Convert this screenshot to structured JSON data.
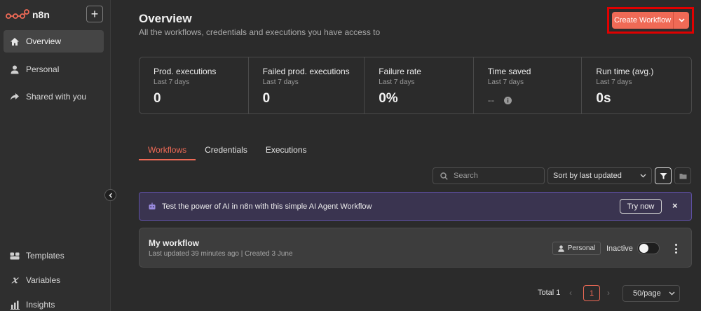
{
  "brand": {
    "name": "n8n",
    "accent": "#ef6a56"
  },
  "sidebar": {
    "new_label": "+",
    "items": [
      {
        "label": "Overview",
        "icon": "home-icon",
        "active": true
      },
      {
        "label": "Personal",
        "icon": "user-icon"
      },
      {
        "label": "Shared with you",
        "icon": "share-icon"
      }
    ],
    "bottom_items": [
      {
        "label": "Templates",
        "icon": "templates-icon"
      },
      {
        "label": "Variables",
        "icon": "variables-icon"
      },
      {
        "label": "Insights",
        "icon": "insights-icon"
      }
    ]
  },
  "header": {
    "title": "Overview",
    "subtitle": "All the workflows, credentials and executions you have access to",
    "create_label": "Create Workflow"
  },
  "stats": [
    {
      "title": "Prod. executions",
      "period": "Last 7 days",
      "value": "0"
    },
    {
      "title": "Failed prod. executions",
      "period": "Last 7 days",
      "value": "0"
    },
    {
      "title": "Failure rate",
      "period": "Last 7 days",
      "value": "0%"
    },
    {
      "title": "Time saved",
      "period": "Last 7 days",
      "value": "--"
    },
    {
      "title": "Run time (avg.)",
      "period": "Last 7 days",
      "value": "0s"
    }
  ],
  "tabs": [
    {
      "label": "Workflows",
      "active": true
    },
    {
      "label": "Credentials"
    },
    {
      "label": "Executions"
    }
  ],
  "toolbar": {
    "search_placeholder": "Search",
    "sort_value": "Sort by last updated"
  },
  "banner": {
    "text": "Test the power of AI in n8n with this simple AI Agent Workflow",
    "cta": "Try now",
    "close": "×"
  },
  "workflows": [
    {
      "name": "My workflow",
      "meta": "Last updated 39 minutes ago | Created 3 June",
      "owner": "Personal",
      "status": "Inactive"
    }
  ],
  "pagination": {
    "total": "Total 1",
    "page": "1",
    "per_page": "50/page"
  }
}
